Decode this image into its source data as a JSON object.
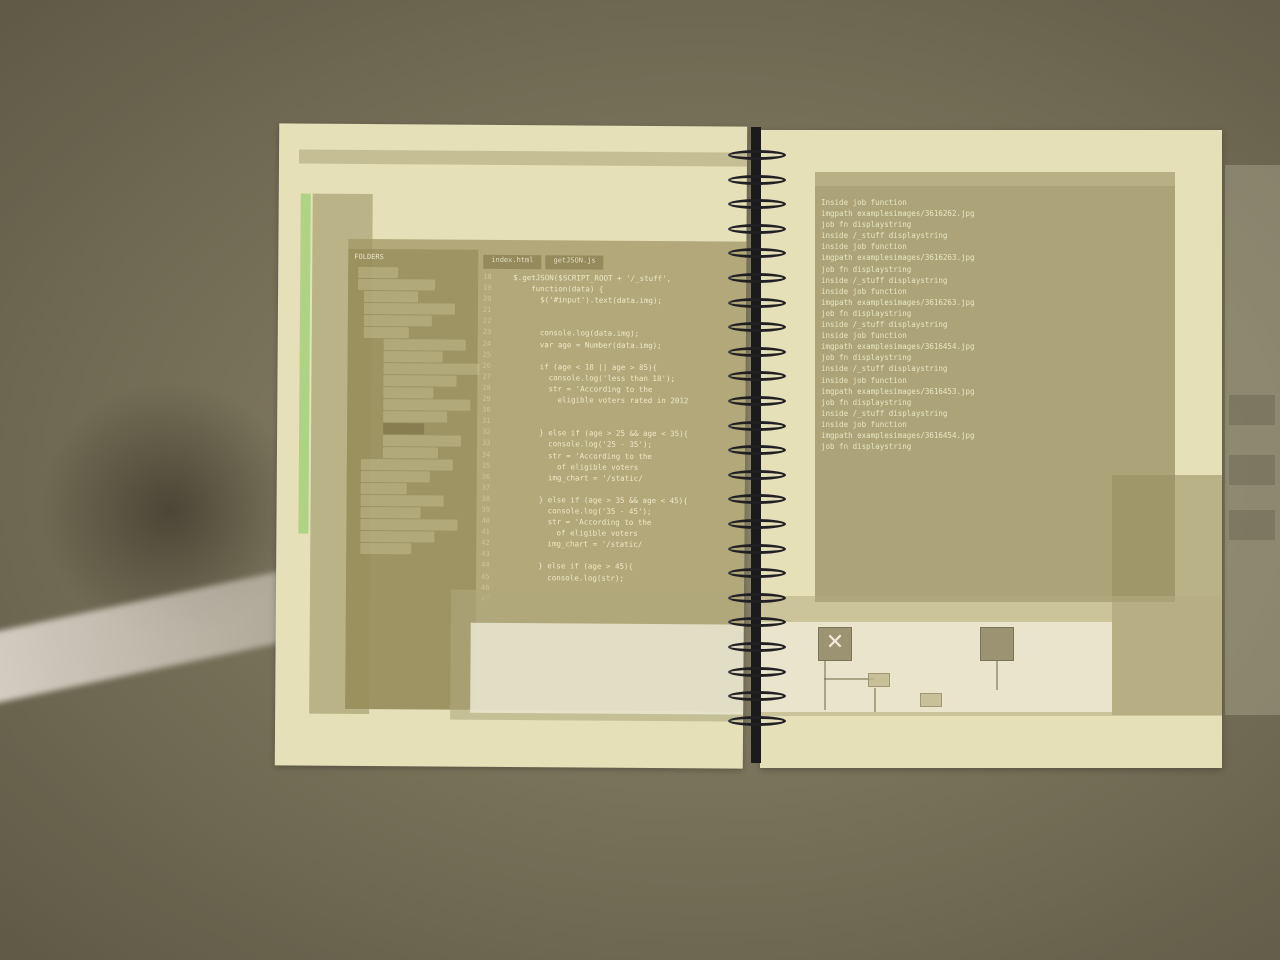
{
  "scene": {
    "description_icon": "notebook-photo",
    "colors": {
      "background": "#7a735b",
      "paper": "#e6e0b8",
      "spiral": "#1b1b1e"
    }
  },
  "left_page": {
    "menubar": [
      "",
      "",
      "",
      "",
      "",
      "",
      "",
      "",
      "",
      "",
      ""
    ],
    "sidebar_header": "FOLDERS",
    "tabs": [
      "index.html",
      "getJSON.js"
    ],
    "line_numbers": [
      "18",
      "19",
      "20",
      "21",
      "22",
      "23",
      "24",
      "25",
      "26",
      "27",
      "28",
      "29",
      "30",
      "31",
      "32",
      "33",
      "34",
      "35",
      "36",
      "37",
      "38",
      "39",
      "40",
      "41",
      "42",
      "43",
      "44",
      "45",
      "46",
      "47"
    ],
    "code_lines": [
      "$.getJSON($SCRIPT_ROOT + '/_stuff',",
      "    function(data) {",
      "      $('#input').text(data.img);",
      "",
      "",
      "      console.log(data.img);",
      "      var age = Number(data.img);",
      "",
      "      if (age < 18 || age > 85){",
      "        console.log('less than 18');",
      "        str = 'According to the",
      "          eligible voters rated in 2012",
      "",
      "",
      "      } else if (age > 25 && age < 35){",
      "        console.log('25 - 35');",
      "        str = 'According to the",
      "          of eligible voters",
      "        img_chart = '/static/",
      "",
      "      } else if (age > 35 && age < 45){",
      "        console.log('35 - 45');",
      "        str = 'According to the",
      "          of eligible voters",
      "        img_chart = '/static/",
      "",
      "      } else if (age > 45){",
      "        console.log(str);",
      "",
      ""
    ]
  },
  "right_page": {
    "console_lines": [
      "Inside job function",
      "imgpath examplesimages/3616262.jpg",
      "job fn displaystring",
      "inside /_stuff displaystring",
      "inside job function",
      "imgpath examplesimages/3616263.jpg",
      "job fn displaystring",
      "inside /_stuff displaystring",
      "inside job function",
      "imgpath examplesimages/3616263.jpg",
      "job fn displaystring",
      "inside /_stuff displaystring",
      "inside job function",
      "imgpath examplesimages/3616454.jpg",
      "job fn displaystring",
      "inside /_stuff displaystring",
      "inside job function",
      "imgpath examplesimages/3616453.jpg",
      "job fn displaystring",
      "inside /_stuff displaystring",
      "inside job function",
      "imgpath examplesimages/3616454.jpg",
      "job fn displaystring"
    ],
    "close_glyph": "✕"
  }
}
